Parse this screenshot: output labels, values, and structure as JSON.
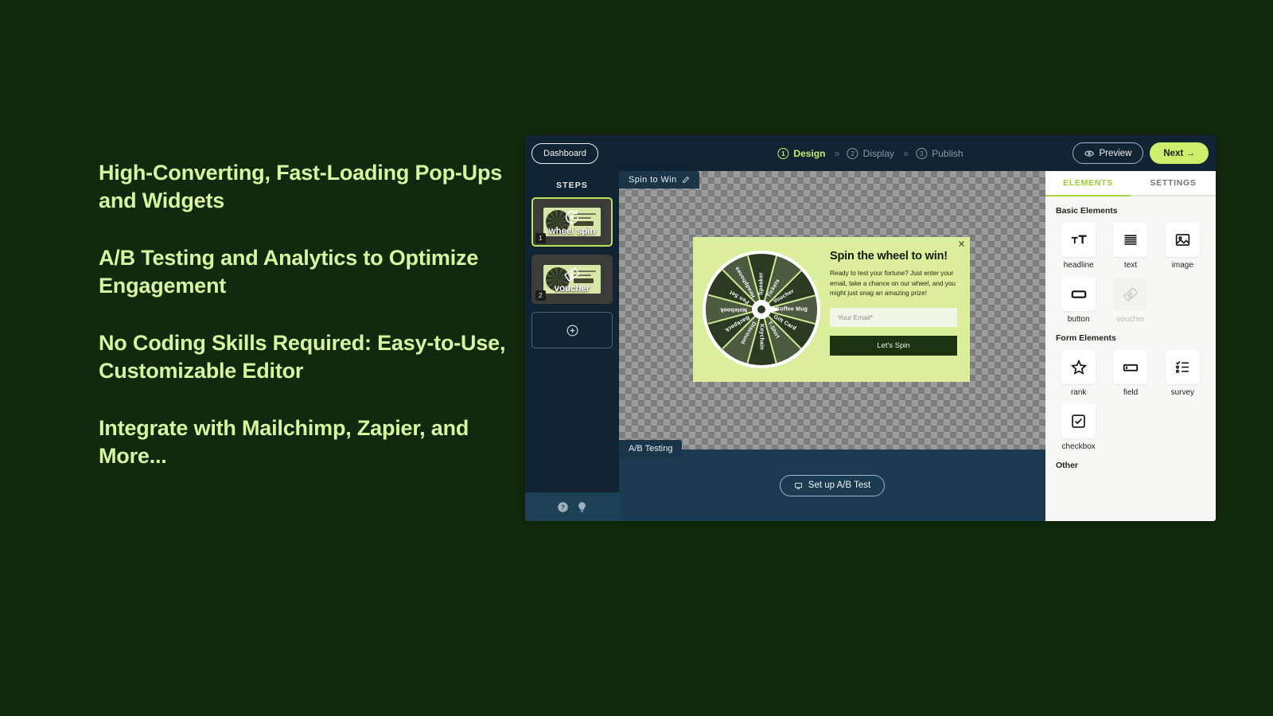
{
  "marketing": {
    "lines": [
      "High-Converting, Fast-Loading Pop-Ups and Widgets",
      "A/B Testing and Analytics to Optimize Engagement",
      "No Coding Skills Required: Easy-to-Use, Customizable Editor",
      "Integrate with Mailchimp, Zapier, and More..."
    ],
    "text_color": "#d9f5a0",
    "background_color": "#13290f"
  },
  "topbar": {
    "dashboard_label": "Dashboard",
    "wizard_steps": [
      {
        "number": "1",
        "label": "Design",
        "state": "active"
      },
      {
        "number": "2",
        "label": "Display",
        "state": "idle"
      },
      {
        "number": "3",
        "label": "Publish",
        "state": "idle"
      }
    ],
    "separator": "»",
    "preview_label": "Preview",
    "preview_icon": "eye-icon",
    "next_label": "Next →",
    "next_color": "#cdee6c",
    "bar_color": "#102434"
  },
  "sidebar": {
    "title": "STEPS",
    "steps": [
      {
        "index": "1",
        "label": "wheel spin",
        "icon": "wheel-spin-icon",
        "selected": true
      },
      {
        "index": "2",
        "label": "voucher",
        "icon": "voucher-icon",
        "selected": false
      }
    ],
    "add_step_icon": "plus-circle-icon",
    "footer_icons": [
      {
        "name": "help-icon",
        "glyph": "?"
      },
      {
        "name": "lightbulb-icon",
        "glyph": "bulb"
      }
    ]
  },
  "canvas": {
    "top_tab_label": "Spin to Win",
    "top_tab_icon": "pencil-edit-icon",
    "bottom_tab_label": "A/B Testing",
    "ab_test_button_label": "Set up A/B Test",
    "ab_test_button_icon": "ab-test-icon"
  },
  "popup": {
    "close_icon": "close-x-icon",
    "title": "Spin the wheel to win!",
    "body": "Ready to test your fortune? Just enter your email, take a chance on our wheel, and you might just snag an amazing prize!",
    "email_placeholder": "Your Email*",
    "submit_label": "Let's Spin",
    "background_color": "#d9ef9b",
    "button_color": "#1d3312",
    "wheel_segments": [
      "Speaker",
      "Tickets",
      "Voucher",
      "Coffee Mug",
      "Gift Card",
      "T-Shirt",
      "Keychain",
      "Discount",
      "Backpack",
      "Notebook",
      "Pen Set",
      "Headphones"
    ]
  },
  "panel": {
    "tabs": [
      {
        "label": "ELEMENTS",
        "active": true
      },
      {
        "label": "SETTINGS",
        "active": false
      }
    ],
    "groups": [
      {
        "title": "Basic Elements",
        "items": [
          {
            "label": "headline",
            "icon": "headline-icon",
            "disabled": false
          },
          {
            "label": "text",
            "icon": "text-lines-icon",
            "disabled": false
          },
          {
            "label": "image",
            "icon": "image-icon",
            "disabled": false
          },
          {
            "label": "button",
            "icon": "button-icon",
            "disabled": false
          },
          {
            "label": "voucher",
            "icon": "voucher-tag-icon",
            "disabled": true
          }
        ]
      },
      {
        "title": "Form Elements",
        "items": [
          {
            "label": "rank",
            "icon": "star-rank-icon",
            "disabled": false
          },
          {
            "label": "field",
            "icon": "input-field-icon",
            "disabled": false
          },
          {
            "label": "survey",
            "icon": "survey-list-icon",
            "disabled": false
          },
          {
            "label": "checkbox",
            "icon": "checkbox-icon",
            "disabled": false
          }
        ]
      },
      {
        "title": "Other",
        "items": []
      }
    ]
  }
}
